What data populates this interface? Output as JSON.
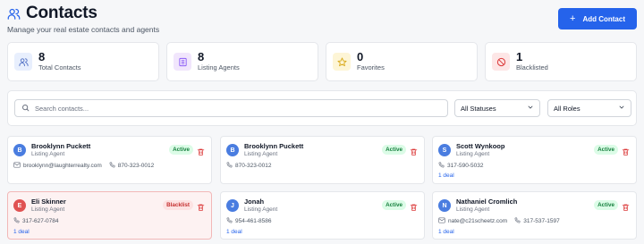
{
  "header": {
    "title": "Contacts",
    "subtitle": "Manage your real estate contacts and agents",
    "add_button": "Add Contact",
    "add_icon": "+"
  },
  "stats": [
    {
      "value": "8",
      "label": "Total Contacts",
      "icon": "users-icon",
      "bg": "#e8effd",
      "fg": "#4f6fc4"
    },
    {
      "value": "8",
      "label": "Listing Agents",
      "icon": "building-icon",
      "bg": "#f1e6fc",
      "fg": "#8b5cf6"
    },
    {
      "value": "0",
      "label": "Favorites",
      "icon": "star-icon",
      "bg": "#fdf5d6",
      "fg": "#d8a91a"
    },
    {
      "value": "1",
      "label": "Blacklisted",
      "icon": "ban-icon",
      "bg": "#fde6e6",
      "fg": "#dc3b3b"
    }
  ],
  "filters": {
    "search_placeholder": "Search contacts...",
    "status_value": "All Statuses",
    "role_value": "All Roles"
  },
  "contacts": [
    {
      "initial": "B",
      "name": "Brooklynn Puckett",
      "role": "Listing Agent",
      "status": "Active",
      "email": "brooklynn@laughterrealty.com",
      "phone": "870-323-0012",
      "deals": ""
    },
    {
      "initial": "B",
      "name": "Brooklynn Puckett",
      "role": "Listing Agent",
      "status": "Active",
      "email": "",
      "phone": "870-323-0012",
      "deals": ""
    },
    {
      "initial": "S",
      "name": "Scott Wynkoop",
      "role": "Listing Agent",
      "status": "Active",
      "email": "",
      "phone": "317-590-5032",
      "deals": "1 deal"
    },
    {
      "initial": "E",
      "name": "Eli Skinner",
      "role": "Listing Agent",
      "status": "Blacklist",
      "email": "",
      "phone": "317-627-0784",
      "deals": "1 deal"
    },
    {
      "initial": "J",
      "name": "Jonah",
      "role": "Listing Agent",
      "status": "Active",
      "email": "",
      "phone": "954-461-8586",
      "deals": "1 deal"
    },
    {
      "initial": "N",
      "name": "Nathaniel Cromlich",
      "role": "Listing Agent",
      "status": "Active",
      "email": "nate@c21scheetz.com",
      "phone": "317-537-1597",
      "deals": "1 deal"
    }
  ],
  "colors": {
    "accent": "#2563eb",
    "active_bg": "#dcfce7",
    "active_fg": "#15803d",
    "blacklist_bg": "#fde2e2",
    "blacklist_fg": "#c53030"
  }
}
